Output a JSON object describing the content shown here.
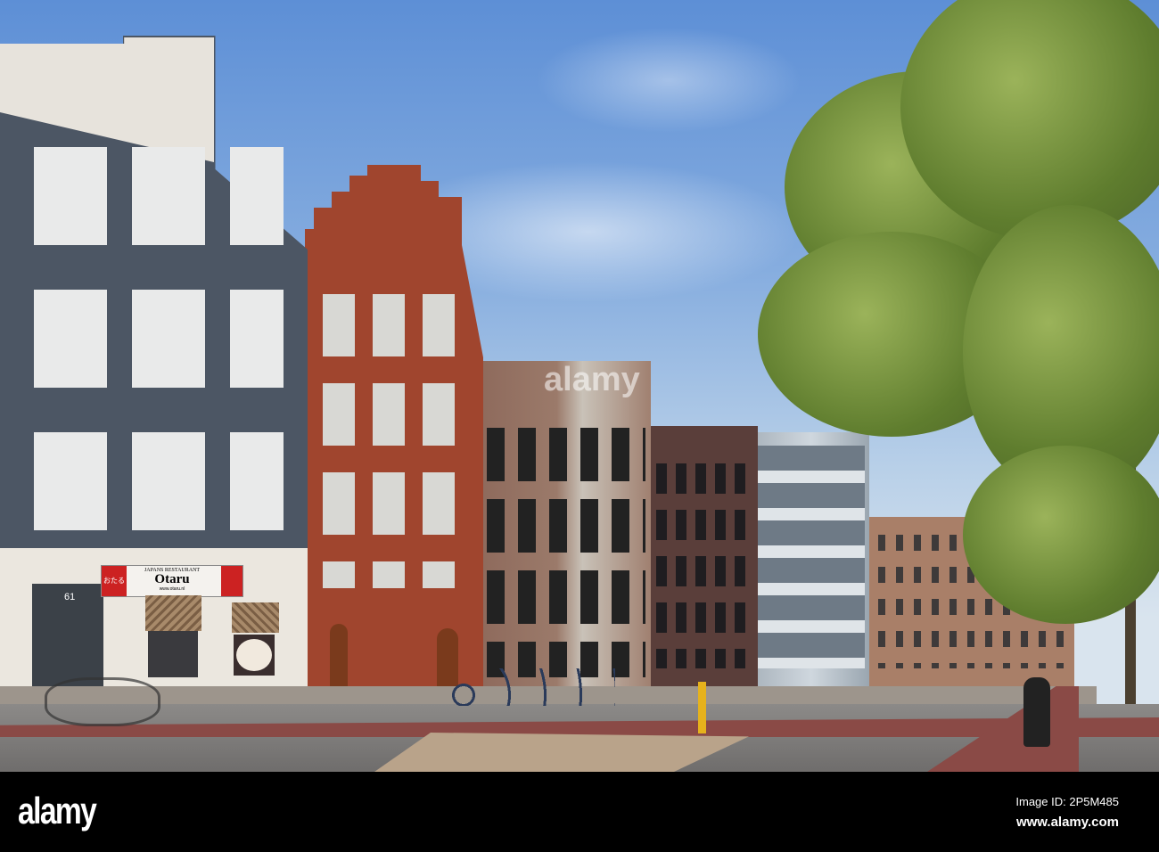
{
  "scene": {
    "restaurant_sign": {
      "subtitle": "JAPANS RESTAURANT",
      "name": "Otaru",
      "website": "www.otaru.nl",
      "logo_text": "おたる"
    },
    "house_number": "61"
  },
  "watermark": {
    "center_text": "alamy"
  },
  "footer": {
    "logo": "alamy",
    "image_id": "Image ID: 2P5M485",
    "url": "www.alamy.com"
  }
}
